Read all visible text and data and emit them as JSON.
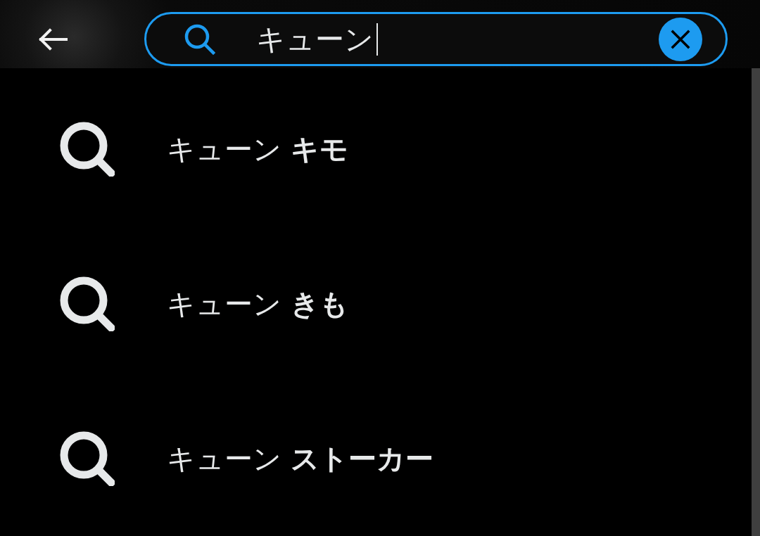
{
  "search": {
    "value": "キューン",
    "focused": true
  },
  "suggestions": [
    {
      "text": "キューン **キモ**"
    },
    {
      "text": "キューン **きも**"
    },
    {
      "text": "キューン **ストーカー**"
    }
  ]
}
